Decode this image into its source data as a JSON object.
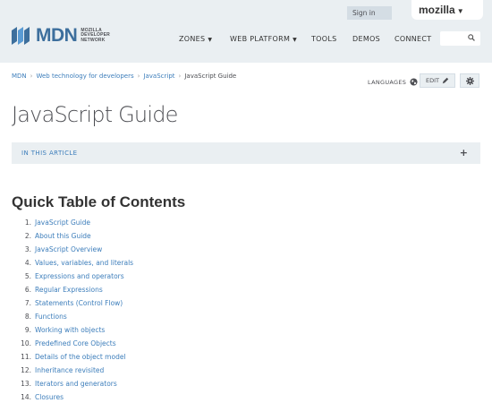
{
  "header": {
    "signin_label": "Sign in",
    "mozilla_label": "mozilla",
    "logo_text": "MDN",
    "logo_sub": [
      "MOZILLA",
      "DEVELOPER",
      "NETWORK"
    ],
    "nav": [
      {
        "label": "ZONES",
        "has_caret": true
      },
      {
        "label": "WEB PLATFORM",
        "has_caret": true
      },
      {
        "label": "TOOLS",
        "has_caret": false
      },
      {
        "label": "DEMOS",
        "has_caret": false
      },
      {
        "label": "CONNECT",
        "has_caret": false
      }
    ]
  },
  "breadcrumb": {
    "links": [
      "MDN",
      "Web technology for developers",
      "JavaScript"
    ],
    "current": "JavaScript Guide"
  },
  "toolbar": {
    "languages_label": "LANGUAGES",
    "edit_label": "EDIT"
  },
  "page_title": "JavaScript Guide",
  "in_article_label": "IN THIS ARTICLE",
  "toc": {
    "heading": "Quick Table of Contents",
    "items": [
      {
        "num": "1.",
        "label": "JavaScript Guide"
      },
      {
        "num": "2.",
        "label": "About this Guide"
      },
      {
        "num": "3.",
        "label": "JavaScript Overview"
      },
      {
        "num": "4.",
        "label": "Values, variables, and literals"
      },
      {
        "num": "5.",
        "label": "Expressions and operators"
      },
      {
        "num": "6.",
        "label": "Regular Expressions"
      },
      {
        "num": "7.",
        "label": "Statements (Control Flow)"
      },
      {
        "num": "8.",
        "label": "Functions"
      },
      {
        "num": "9.",
        "label": "Working with objects"
      },
      {
        "num": "10.",
        "label": "Predefined Core Objects"
      },
      {
        "num": "11.",
        "label": "Details of the object model"
      },
      {
        "num": "12.",
        "label": "Inheritance revisited"
      },
      {
        "num": "13.",
        "label": "Iterators and generators"
      },
      {
        "num": "14.",
        "label": "Closures"
      }
    ]
  },
  "colors": {
    "link": "#3d7ebb",
    "header_bg": "#eaeff2",
    "logo_blue": "#3d6f9d"
  }
}
